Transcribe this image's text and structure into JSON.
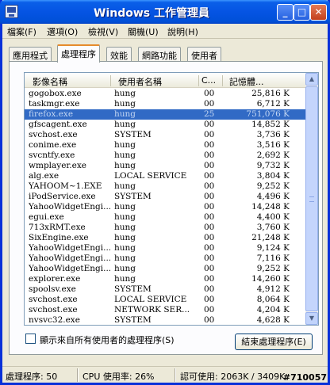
{
  "window": {
    "title": "Windows 工作管理員"
  },
  "titlebar": {
    "min": "_",
    "max": "□",
    "close": "✕"
  },
  "menu": {
    "items": [
      "檔案(F)",
      "選項(O)",
      "檢視(V)",
      "關機(U)",
      "說明(H)"
    ]
  },
  "tabs": [
    "應用程式",
    "處理程序",
    "效能",
    "網路功能",
    "使用者"
  ],
  "active_tab": "處理程序",
  "table": {
    "columns": [
      "影像名稱",
      "使用者名稱",
      "C...",
      "記憶體..."
    ],
    "rows": [
      [
        "gogobox.exe",
        "hung",
        "00",
        "25,816 K"
      ],
      [
        "taskmgr.exe",
        "hung",
        "00",
        "6,712 K"
      ],
      [
        "firefox.exe",
        "hung",
        "25",
        "751,076 K"
      ],
      [
        "gfscagent.exe",
        "hung",
        "00",
        "14,852 K"
      ],
      [
        "svchost.exe",
        "SYSTEM",
        "00",
        "3,736 K"
      ],
      [
        "conime.exe",
        "hung",
        "00",
        "3,516 K"
      ],
      [
        "svcntfy.exe",
        "hung",
        "00",
        "2,692 K"
      ],
      [
        "wmplayer.exe",
        "hung",
        "00",
        "9,732 K"
      ],
      [
        "alg.exe",
        "LOCAL SERVICE",
        "00",
        "3,804 K"
      ],
      [
        "YAHOOM~1.EXE",
        "hung",
        "00",
        "9,252 K"
      ],
      [
        "iPodService.exe",
        "SYSTEM",
        "00",
        "4,496 K"
      ],
      [
        "YahooWidgetEngi...",
        "hung",
        "00",
        "14,248 K"
      ],
      [
        "egui.exe",
        "hung",
        "00",
        "4,400 K"
      ],
      [
        "713xRMT.exe",
        "hung",
        "00",
        "3,760 K"
      ],
      [
        "SixEngine.exe",
        "hung",
        "00",
        "21,248 K"
      ],
      [
        "YahooWidgetEngi...",
        "hung",
        "00",
        "9,124 K"
      ],
      [
        "YahooWidgetEngi...",
        "hung",
        "00",
        "7,116 K"
      ],
      [
        "YahooWidgetEngi...",
        "hung",
        "00",
        "9,252 K"
      ],
      [
        "explorer.exe",
        "hung",
        "00",
        "14,260 K"
      ],
      [
        "spoolsv.exe",
        "SYSTEM",
        "00",
        "4,912 K"
      ],
      [
        "svchost.exe",
        "LOCAL SERVICE",
        "00",
        "8,064 K"
      ],
      [
        "svchost.exe",
        "NETWORK SER...",
        "00",
        "4,204 K"
      ],
      [
        "nvsvc32.exe",
        "SYSTEM",
        "00",
        "4,628 K"
      ]
    ],
    "selected_index": 2
  },
  "show_all_users": {
    "label": "顯示來自所有使用者的處理程序(S)",
    "checked": false
  },
  "end_process_button": "結束處理程序(E)",
  "status": {
    "processes": "處理程序: 50",
    "cpu": "CPU 使用率: 26%",
    "commit": "認可使用: 2063K / 3409K"
  },
  "watermark": "#710057",
  "colors": {
    "selection": "#316ac5",
    "titlebar": "#0554e3"
  }
}
